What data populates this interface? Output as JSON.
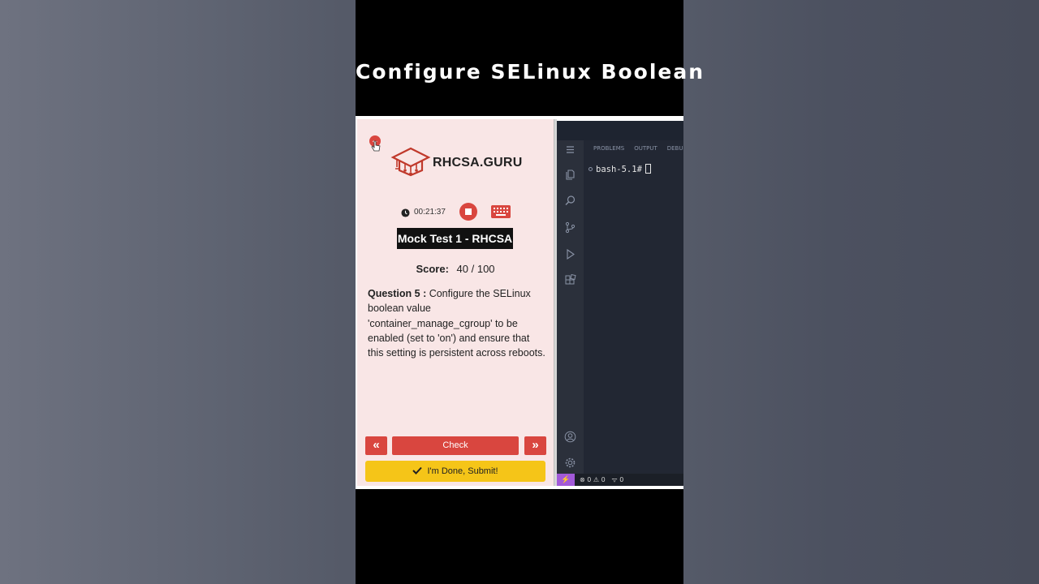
{
  "video": {
    "title": "Configure SELinux Boolean"
  },
  "app": {
    "brand": "RHCSA.GURU",
    "timer": "00:21:37",
    "test_title": "Mock Test 1 - RHCSA",
    "score_label": "Score:",
    "score_value": "40 / 100",
    "question_label": "Question 5 :",
    "question_text": " Configure the SELinux boolean value 'container_manage_cgroup' to be enabled (set to 'on') and ensure that this setting is persistent across reboots.",
    "prev_label": "«",
    "next_label": "»",
    "check_label": "Check",
    "submit_label": "I'm Done, Submit!",
    "accent": "#d9463f",
    "submit_color": "#f5c518"
  },
  "editor": {
    "tabs": [
      "PROBLEMS",
      "OUTPUT",
      "DEBU"
    ],
    "terminal_prompt": "bash-5.1#",
    "status": {
      "errors": "0",
      "warnings": "0",
      "ports": "0"
    }
  }
}
